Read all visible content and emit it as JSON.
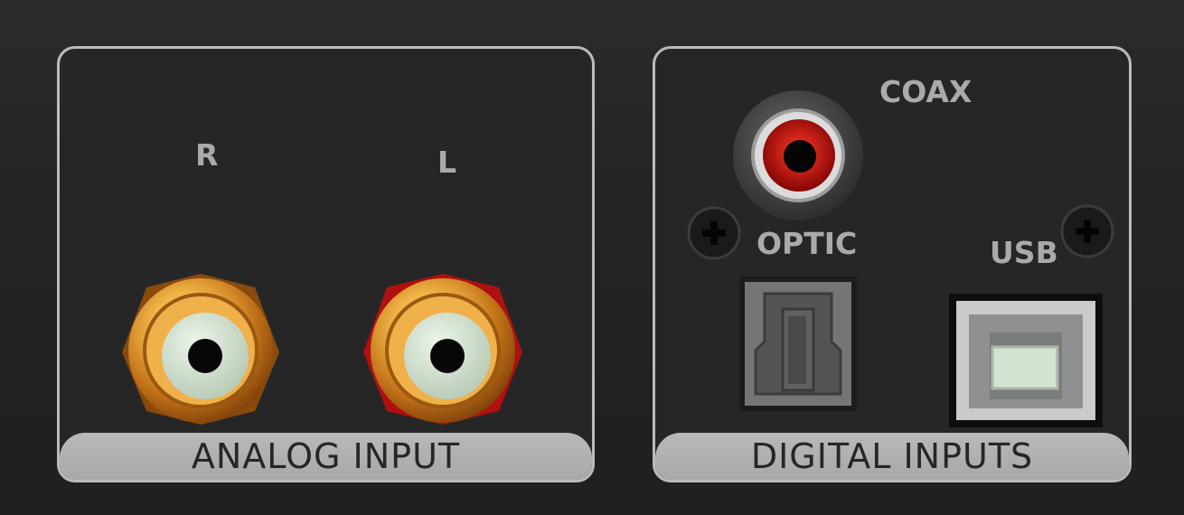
{
  "analog_section": {
    "title": "ANALOG INPUT",
    "right_label": "R",
    "left_label": "L"
  },
  "digital_section": {
    "title": "DIGITAL INPUTS",
    "coax_label": "COAX",
    "optic_label": "OPTIC",
    "usb_label": "USB"
  },
  "colors": {
    "panel_background": "#262627",
    "panel_border": "#b9bbbc",
    "label_text": "#a9aaab",
    "gold": "#d9962c",
    "red_marker": "#c01010",
    "insulator": "#d3e3d2"
  }
}
